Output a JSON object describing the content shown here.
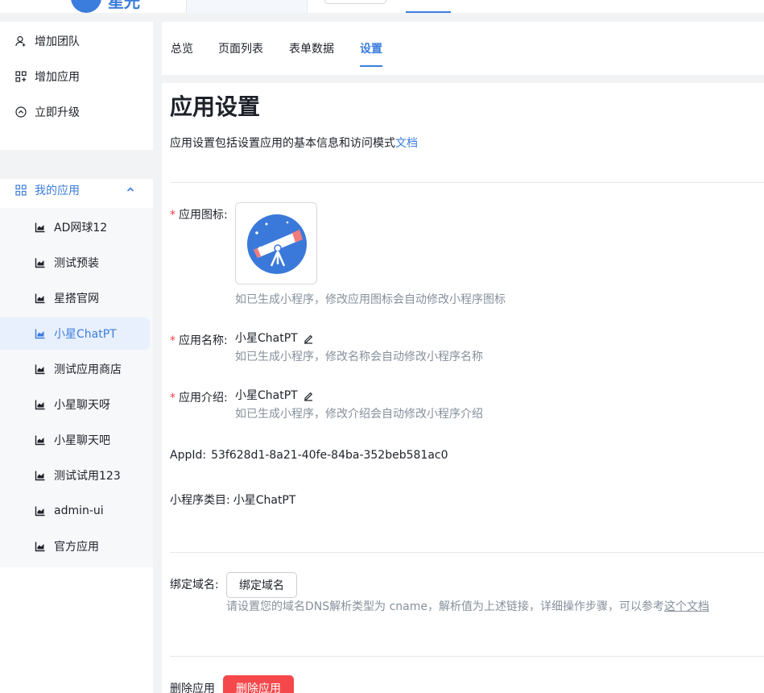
{
  "header": {
    "logo_text": "星光"
  },
  "sidebar": {
    "actions": [
      {
        "label": "增加团队",
        "icon": "user-icon"
      },
      {
        "label": "增加应用",
        "icon": "app-add-icon"
      },
      {
        "label": "立即升级",
        "icon": "upgrade-icon"
      }
    ],
    "group": {
      "label": "我的应用",
      "icon": "grid-icon",
      "expanded": true
    },
    "apps": [
      {
        "label": "AD网球12"
      },
      {
        "label": "测试预装"
      },
      {
        "label": "星搭官网"
      },
      {
        "label": "小星ChatPT",
        "active": true
      },
      {
        "label": "测试应用商店"
      },
      {
        "label": "小星聊天呀"
      },
      {
        "label": "小星聊天吧"
      },
      {
        "label": "测试试用123"
      },
      {
        "label": "admin-ui"
      },
      {
        "label": "官方应用"
      }
    ]
  },
  "tabs": [
    {
      "label": "总览"
    },
    {
      "label": "页面列表"
    },
    {
      "label": "表单数据"
    },
    {
      "label": "设置",
      "active": true
    }
  ],
  "main": {
    "title": "应用设置",
    "description": "应用设置包括设置应用的基本信息和访问模式",
    "doc_link": "文档",
    "icon_field": {
      "label": "应用图标:",
      "hint": "如已生成小程序，修改应用图标会自动修改小程序图标"
    },
    "name_field": {
      "label": "应用名称:",
      "value": "小星ChatPT",
      "hint": "如已生成小程序，修改名称会自动修改小程序名称"
    },
    "intro_field": {
      "label": "应用介绍:",
      "value": "小星ChatPT",
      "hint": "如已生成小程序，修改介绍会自动修改小程序介绍"
    },
    "appid": {
      "label": "AppId:",
      "value": "53f628d1-8a21-40fe-84ba-352beb581ac0"
    },
    "mini_category": {
      "label": "小程序类目:",
      "value": "小星ChatPT"
    },
    "domain": {
      "label": "绑定域名:",
      "button": "绑定域名",
      "hint": "请设置您的域名DNS解析类型为 cname，解析值为上述链接，详细操作步骤，可以参考",
      "hint_link": "这个文档"
    },
    "delete": {
      "label": "删除应用",
      "button": "删除应用"
    }
  },
  "colors": {
    "accent": "#3b7ddd",
    "danger": "#f5484b",
    "required": "#f53f3f"
  }
}
